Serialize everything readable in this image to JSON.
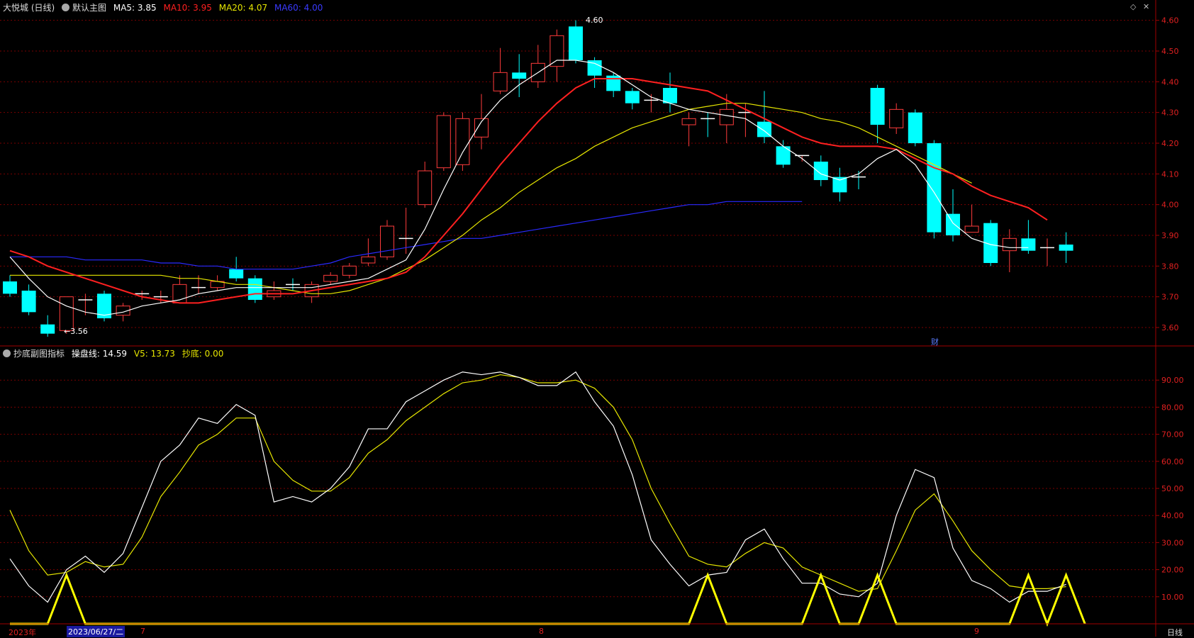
{
  "top_header": {
    "stock": "大悦城 (日线)",
    "main_chart": "默认主图",
    "ma5": "MA5: 3.85",
    "ma10": "MA10: 3.95",
    "ma20": "MA20: 4.07",
    "ma60": "MA60: 4.00"
  },
  "bottom_header": {
    "indicator": "抄底副图指标",
    "line1": "操盘线: 14.59",
    "line2": "V5: 13.73",
    "line3": "抄底: 0.00"
  },
  "bottom_right_label": "日线",
  "corner_icons": [
    "diamond-icon",
    "close-icon"
  ],
  "colors": {
    "up": "#ff3b3b",
    "down": "#00ffff",
    "ma5": "#ffffff",
    "ma10": "#ff2020",
    "ma20": "#e6e600",
    "ma60": "#2a2aff",
    "grid": "#7a0000"
  },
  "chart_data": [
    {
      "type": "candlestick",
      "ylim": [
        3.54,
        4.62
      ],
      "yticks": [
        "4.60",
        "4.50",
        "4.40",
        "4.30",
        "4.20",
        "4.10",
        "4.00",
        "3.90",
        "3.80",
        "3.70",
        "3.60"
      ],
      "annotations": {
        "high": "4.60",
        "low": "←3.56",
        "event": "财"
      },
      "candles": [
        [
          3.75,
          3.77,
          3.71,
          3.7
        ],
        [
          3.72,
          3.74,
          3.65,
          3.64
        ],
        [
          3.61,
          3.64,
          3.58,
          3.57
        ],
        [
          3.59,
          3.69,
          3.7,
          3.58
        ],
        [
          3.68,
          3.71,
          3.69,
          3.64
        ],
        [
          3.71,
          3.72,
          3.63,
          3.62
        ],
        [
          3.64,
          3.68,
          3.67,
          3.62
        ],
        [
          3.7,
          3.72,
          3.71,
          3.69
        ],
        [
          3.7,
          3.72,
          3.7,
          3.68
        ],
        [
          3.68,
          3.77,
          3.74,
          3.68
        ],
        [
          3.72,
          3.77,
          3.73,
          3.71
        ],
        [
          3.73,
          3.77,
          3.75,
          3.72
        ],
        [
          3.79,
          3.83,
          3.76,
          3.75
        ],
        [
          3.76,
          3.77,
          3.69,
          3.68
        ],
        [
          3.7,
          3.75,
          3.72,
          3.69
        ],
        [
          3.74,
          3.76,
          3.73,
          3.72
        ],
        [
          3.7,
          3.75,
          3.74,
          3.68
        ],
        [
          3.75,
          3.78,
          3.77,
          3.74
        ],
        [
          3.77,
          3.81,
          3.8,
          3.76
        ],
        [
          3.81,
          3.89,
          3.83,
          3.8
        ],
        [
          3.83,
          3.95,
          3.93,
          3.82
        ],
        [
          3.88,
          3.99,
          3.89,
          3.84
        ],
        [
          4.0,
          4.14,
          4.11,
          3.99
        ],
        [
          4.12,
          4.3,
          4.29,
          4.11
        ],
        [
          4.13,
          4.3,
          4.28,
          4.11
        ],
        [
          4.22,
          4.36,
          4.28,
          4.18
        ],
        [
          4.37,
          4.51,
          4.43,
          4.36
        ],
        [
          4.43,
          4.49,
          4.41,
          4.35
        ],
        [
          4.4,
          4.52,
          4.46,
          4.38
        ],
        [
          4.45,
          4.57,
          4.55,
          4.4
        ],
        [
          4.58,
          4.6,
          4.47,
          4.46
        ],
        [
          4.47,
          4.48,
          4.42,
          4.38
        ],
        [
          4.42,
          4.43,
          4.37,
          4.35
        ],
        [
          4.37,
          4.38,
          4.33,
          4.31
        ],
        [
          4.34,
          4.36,
          4.34,
          4.3
        ],
        [
          4.38,
          4.43,
          4.33,
          4.3
        ],
        [
          4.26,
          4.3,
          4.28,
          4.19
        ],
        [
          4.28,
          4.3,
          4.27,
          4.22
        ],
        [
          4.26,
          4.36,
          4.31,
          4.2
        ],
        [
          4.3,
          4.33,
          4.3,
          4.22
        ],
        [
          4.27,
          4.37,
          4.22,
          4.2
        ],
        [
          4.19,
          4.21,
          4.13,
          4.12
        ],
        [
          4.15,
          4.16,
          4.16,
          4.14
        ],
        [
          4.14,
          4.16,
          4.08,
          4.06
        ],
        [
          4.09,
          4.12,
          4.04,
          4.01
        ],
        [
          4.09,
          4.11,
          4.08,
          4.05
        ],
        [
          4.38,
          4.39,
          4.26,
          4.2
        ],
        [
          4.25,
          4.33,
          4.31,
          4.23
        ],
        [
          4.3,
          4.31,
          4.2,
          4.19
        ],
        [
          4.2,
          4.21,
          3.91,
          3.89
        ],
        [
          3.97,
          4.05,
          3.9,
          3.88
        ],
        [
          3.91,
          4.0,
          3.93,
          3.91
        ],
        [
          3.94,
          3.95,
          3.81,
          3.8
        ],
        [
          3.85,
          3.92,
          3.89,
          3.78
        ],
        [
          3.89,
          3.95,
          3.85,
          3.84
        ],
        [
          3.86,
          3.89,
          3.86,
          3.8
        ],
        [
          3.87,
          3.91,
          3.85,
          3.81
        ]
      ],
      "ma5": [
        3.83,
        3.76,
        3.7,
        3.67,
        3.65,
        3.64,
        3.65,
        3.67,
        3.68,
        3.69,
        3.71,
        3.72,
        3.73,
        3.73,
        3.73,
        3.73,
        3.73,
        3.74,
        3.75,
        3.76,
        3.79,
        3.82,
        3.92,
        4.05,
        4.17,
        4.27,
        4.34,
        4.39,
        4.43,
        4.47,
        4.47,
        4.46,
        4.43,
        4.39,
        4.35,
        4.33,
        4.31,
        4.3,
        4.29,
        4.28,
        4.24,
        4.19,
        4.15,
        4.1,
        4.08,
        4.1,
        4.15,
        4.18,
        4.13,
        4.04,
        3.94,
        3.89,
        3.87,
        3.86,
        3.86
      ],
      "ma10": [
        3.85,
        3.83,
        3.8,
        3.78,
        3.76,
        3.74,
        3.72,
        3.7,
        3.69,
        3.68,
        3.68,
        3.69,
        3.7,
        3.71,
        3.71,
        3.71,
        3.72,
        3.73,
        3.74,
        3.75,
        3.76,
        3.78,
        3.83,
        3.9,
        3.97,
        4.05,
        4.13,
        4.2,
        4.27,
        4.33,
        4.38,
        4.41,
        4.41,
        4.41,
        4.4,
        4.39,
        4.38,
        4.37,
        4.34,
        4.31,
        4.28,
        4.25,
        4.22,
        4.2,
        4.19,
        4.19,
        4.19,
        4.18,
        4.15,
        4.12,
        4.1,
        4.06,
        4.03,
        4.01,
        3.99,
        3.95
      ],
      "ma20": [
        3.77,
        3.77,
        3.77,
        3.77,
        3.77,
        3.77,
        3.77,
        3.77,
        3.77,
        3.76,
        3.76,
        3.75,
        3.74,
        3.74,
        3.73,
        3.72,
        3.71,
        3.71,
        3.72,
        3.74,
        3.76,
        3.79,
        3.82,
        3.86,
        3.9,
        3.95,
        3.99,
        4.04,
        4.08,
        4.12,
        4.15,
        4.19,
        4.22,
        4.25,
        4.27,
        4.29,
        4.31,
        4.32,
        4.33,
        4.33,
        4.32,
        4.31,
        4.3,
        4.28,
        4.27,
        4.25,
        4.22,
        4.19,
        4.16,
        4.13,
        4.1,
        4.07
      ],
      "ma60": [
        3.83,
        3.83,
        3.83,
        3.83,
        3.82,
        3.82,
        3.82,
        3.82,
        3.81,
        3.81,
        3.8,
        3.8,
        3.79,
        3.79,
        3.79,
        3.79,
        3.8,
        3.81,
        3.83,
        3.84,
        3.85,
        3.86,
        3.87,
        3.88,
        3.89,
        3.89,
        3.9,
        3.91,
        3.92,
        3.93,
        3.94,
        3.95,
        3.96,
        3.97,
        3.98,
        3.99,
        4.0,
        4.0,
        4.01,
        4.01,
        4.01,
        4.01,
        4.01
      ]
    },
    {
      "type": "line",
      "ylim": [
        0,
        100
      ],
      "yticks": [
        "90.00",
        "80.00",
        "70.00",
        "60.00",
        "50.00",
        "40.00",
        "30.00",
        "20.00",
        "10.00"
      ],
      "series": [
        {
          "name": "操盘线",
          "color": "#ffffff",
          "values": [
            24,
            14,
            8,
            20,
            25,
            19,
            26,
            43,
            60,
            66,
            76,
            74,
            81,
            77,
            45,
            47,
            45,
            50,
            58,
            72,
            72,
            82,
            86,
            90,
            93,
            92,
            93,
            91,
            88,
            88,
            93,
            82,
            73,
            55,
            31,
            22,
            14,
            18,
            19,
            31,
            35,
            24,
            15,
            15,
            11,
            10,
            15,
            40,
            57,
            54,
            28,
            16,
            13,
            8,
            12,
            12,
            14.59
          ]
        },
        {
          "name": "V5",
          "color": "#e6e600",
          "values": [
            42,
            27,
            18,
            19,
            23,
            21,
            22,
            32,
            47,
            56,
            66,
            70,
            76,
            76,
            60,
            53,
            49,
            49,
            54,
            63,
            68,
            75,
            80,
            85,
            89,
            90,
            92,
            91,
            89,
            89,
            90,
            87,
            80,
            68,
            50,
            37,
            25,
            22,
            21,
            26,
            30,
            28,
            21,
            18,
            15,
            12,
            13,
            27,
            42,
            48,
            38,
            27,
            20,
            14,
            13,
            13,
            13.73
          ]
        },
        {
          "name": "抄底",
          "color": "#ffff00",
          "values": [
            0,
            0,
            0,
            18,
            0,
            0,
            0,
            0,
            0,
            0,
            0,
            0,
            0,
            0,
            0,
            0,
            0,
            0,
            0,
            0,
            0,
            0,
            0,
            0,
            0,
            0,
            0,
            0,
            0,
            0,
            0,
            0,
            0,
            0,
            0,
            0,
            0,
            18,
            0,
            0,
            0,
            0,
            0,
            18,
            0,
            0,
            18,
            0,
            0,
            0,
            0,
            0,
            0,
            0,
            18,
            0,
            18,
            0
          ]
        }
      ]
    }
  ],
  "x_axis": {
    "labels": [
      "2023年",
      "2023/06/27/二",
      "7",
      "8",
      "9"
    ]
  }
}
